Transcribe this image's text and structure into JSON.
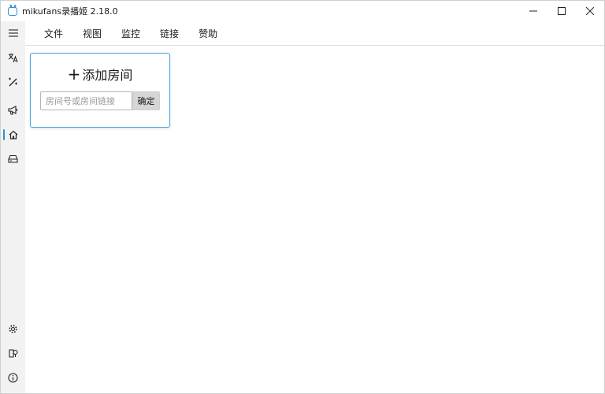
{
  "window": {
    "title": "mikufans录播姬 2.18.0",
    "controls": [
      "minimize-icon",
      "maximize-icon",
      "close-icon"
    ]
  },
  "menu": {
    "items": [
      {
        "label": "文件"
      },
      {
        "label": "视图"
      },
      {
        "label": "监控"
      },
      {
        "label": "链接"
      },
      {
        "label": "赞助"
      }
    ]
  },
  "sidebar": {
    "top_icons": [
      "hamburger-menu-icon",
      "translate-icon",
      "magic-wand-icon",
      "megaphone-icon",
      "home-icon",
      "storage-drive-icon"
    ],
    "bottom_icons": [
      "settings-gear-icon",
      "logs-icon",
      "info-icon"
    ],
    "active": "home-icon",
    "accent_color": "#2e8fd1"
  },
  "add_room": {
    "title": "添加房间",
    "input_value": "",
    "input_placeholder": "房间号或房间链接",
    "confirm_label": "确定",
    "border_color": "#4aa6df"
  }
}
